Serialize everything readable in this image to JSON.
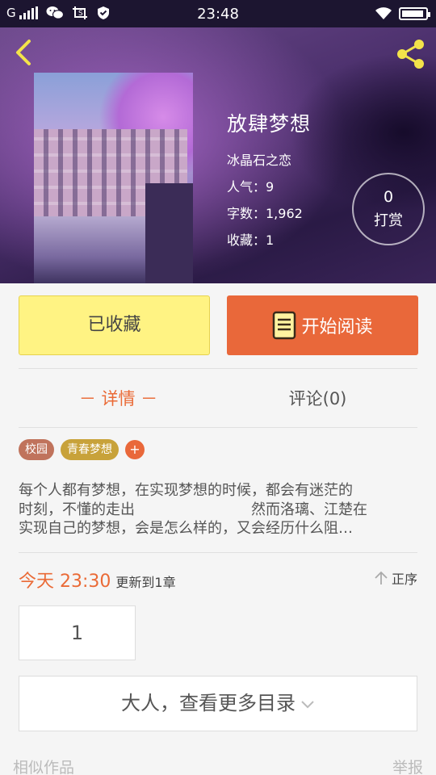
{
  "status_bar": {
    "carrier": "G",
    "time": "23:48",
    "icons": [
      "signal-icon",
      "wechat-icon",
      "screenshot-icon",
      "shield-icon",
      "wifi-icon",
      "battery-icon"
    ]
  },
  "header": {
    "back_icon": "chevron-left-icon",
    "share_icon": "share-icon"
  },
  "book": {
    "title": "放肆梦想",
    "author": "冰晶石之恋",
    "popularity": "人气：9",
    "word_count": "字数：1,962",
    "favorites": "收藏：1"
  },
  "tip": {
    "count": "0",
    "label": "打赏"
  },
  "actions": {
    "favorite_label": "已收藏",
    "read_label": "开始阅读"
  },
  "tabs": [
    {
      "label": "－ 详情 －",
      "active": true
    },
    {
      "label": "评论(0)",
      "active": false
    }
  ],
  "tags": [
    {
      "label": "校园",
      "color": "#c0735c"
    },
    {
      "label": "青春梦想",
      "color": "#c8a23a"
    }
  ],
  "tag_add": "+",
  "description": [
    "每个人都有梦想，在实现梦想的时候，都会有迷茫的",
    "时刻，不懂的走出　　　　　　　　然而洛璃、江楚在",
    "实现自己的梦想，会是怎么样的，又会经历什么阻…"
  ],
  "update": {
    "time": "今天 23:30",
    "text": "更新到1章"
  },
  "order_label": "正序",
  "chapter_number": "1",
  "more_label": "大人，查看更多目录",
  "footer": {
    "similar": "相似作品",
    "report": "举报"
  },
  "colors": {
    "accent": "#e9683a",
    "favorite_bg": "#fff383"
  }
}
